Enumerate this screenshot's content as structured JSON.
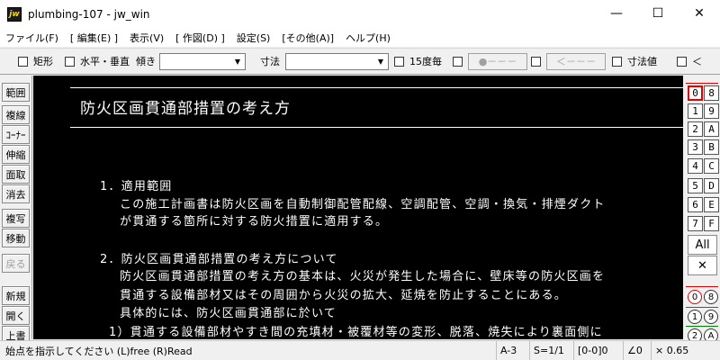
{
  "window": {
    "logo": "jw",
    "title": "plumbing-107 - jw_win",
    "minimize": "—",
    "maximize": "☐",
    "close": "✕"
  },
  "menu": [
    "ファイル(F)",
    "[ 編集(E) ]",
    "表示(V)",
    "[ 作図(D) ]",
    "設定(S)",
    "[その他(A)]",
    "ヘルプ(H)"
  ],
  "toolbar": {
    "rect": "矩形",
    "hv": "水平・垂直",
    "tilt": "傾き",
    "tilt_value": "",
    "dim": "寸法",
    "dim_value": "",
    "deg15": "15度毎",
    "point_style": "●－－－",
    "arrow_style": "＜－－－",
    "dim_value_label": "寸法値",
    "lt": "＜"
  },
  "left_tools": [
    "範囲",
    "複線",
    "ｺｰﾅｰ",
    "伸縮",
    "面取",
    "消去",
    "複写",
    "移動",
    "戻る",
    "新規",
    "開く",
    "上書"
  ],
  "document": {
    "heading": "防火区画貫通部措置の考え方",
    "lines": [
      "1．適用範囲",
      "この施工計画書は防火区画を自動制御配管配線、空調配管、空調・換気・排煙ダクト",
      "が貫通する箇所に対する防火措置に適用する。",
      "2．防火区画貫通部措置の考え方について",
      "防火区画貫通部措置の考え方の基本は、火災が発生した場合に、壁床等の防火区画を",
      "貫通する設備部材又はその周囲から火災の拡大、延焼を防止することにある。",
      "具体的には、防火区画貫通部に於いて",
      "1）貫通する設備部材やすき間の充填材・被覆材等の変形、脱落、焼失により裏面側に"
    ]
  },
  "right_palette": {
    "layers_left": [
      "0",
      "1",
      "2",
      "3",
      "4",
      "5",
      "6",
      "7"
    ],
    "layers_right": [
      "8",
      "9",
      "A",
      "B",
      "C",
      "D",
      "E",
      "F"
    ],
    "all": "All",
    "cross": "✕",
    "groups_left": [
      "0",
      "1",
      "2"
    ],
    "groups_right": [
      "8",
      "9",
      "A"
    ]
  },
  "status": {
    "message": "始点を指示してください (L)free (R)Read",
    "paper": "A-3",
    "scale": "S=1/1",
    "layer": "[0-0]0",
    "angle": "∠0",
    "zoom": "× 0.65"
  }
}
